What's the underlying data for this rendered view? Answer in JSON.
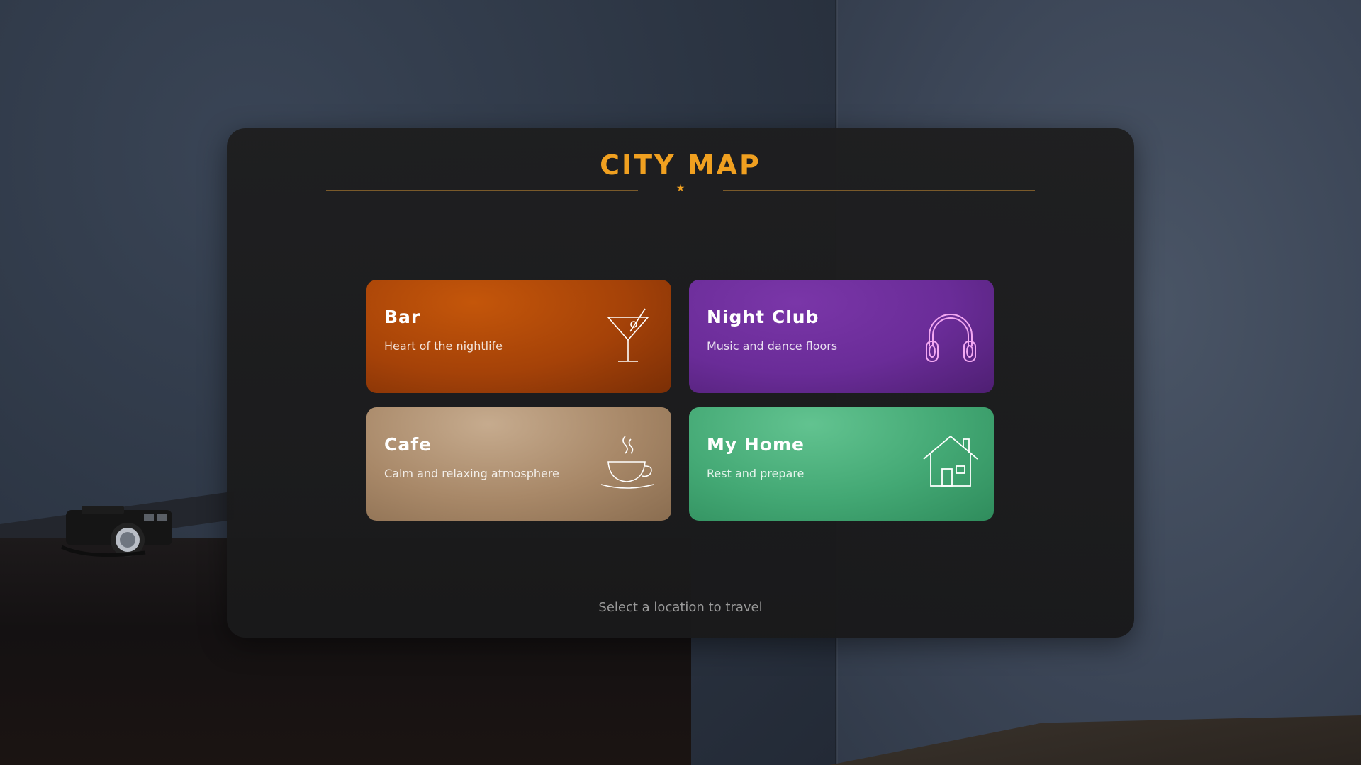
{
  "title": "CITY MAP",
  "divider_glyph": "★",
  "locations": [
    {
      "name": "Bar",
      "description": "Heart of the nightlife",
      "icon": "cocktail-icon",
      "color": "#a54208"
    },
    {
      "name": "Night Club",
      "description": "Music and dance floors",
      "icon": "headphones-icon",
      "color": "#6a2c98"
    },
    {
      "name": "Cafe",
      "description": "Calm and relaxing atmosphere",
      "icon": "coffee-cup-icon",
      "color": "#a88868"
    },
    {
      "name": "My Home",
      "description": "Rest and prepare",
      "icon": "house-icon",
      "color": "#43a874"
    }
  ],
  "footer_hint": "Select a location to travel",
  "accent_color": "#f0a020"
}
